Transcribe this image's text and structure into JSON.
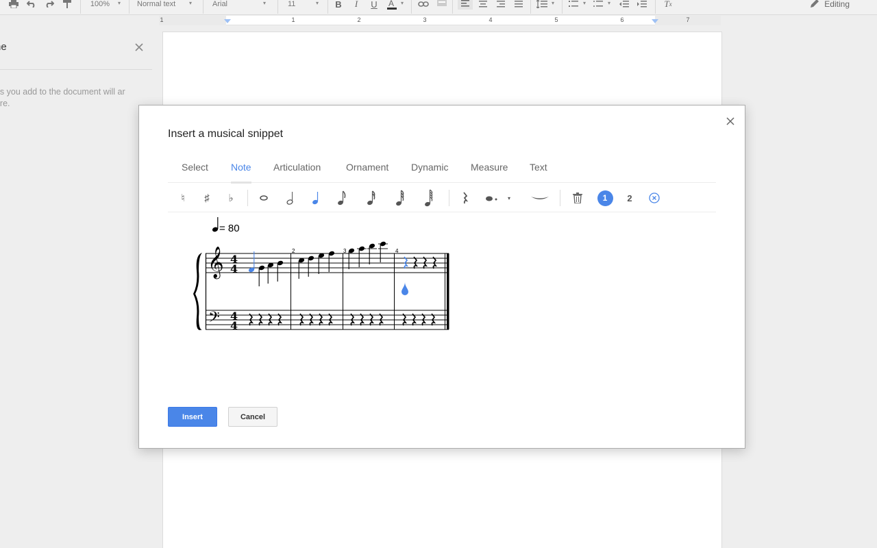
{
  "toolbar": {
    "zoom": "100%",
    "style": "Normal text",
    "font": "Arial",
    "font_size": "11",
    "mode": "Editing"
  },
  "ruler": {
    "numbers": [
      "1",
      "1",
      "2",
      "3",
      "4",
      "5",
      "6",
      "7"
    ]
  },
  "left_panel": {
    "title_fragment": "ne",
    "description_fragment": "ngs you add to the document will ar here."
  },
  "dialog": {
    "title": "Insert a musical snippet",
    "tabs": [
      "Select",
      "Note",
      "Articulation",
      "Ornament",
      "Dynamic",
      "Measure",
      "Text"
    ],
    "active_tab": "Note",
    "palette": {
      "voices": [
        "1",
        "2"
      ],
      "active_voice": "1",
      "icons": [
        "natural-icon",
        "sharp-icon",
        "flat-icon",
        "whole-note-icon",
        "half-note-icon",
        "quarter-note-icon",
        "eighth-note-icon",
        "sixteenth-note-icon",
        "thirty-second-note-icon",
        "sixty-fourth-note-icon",
        "rest-icon",
        "dot-icon",
        "tie-icon",
        "trash-icon",
        "clear-voice-icon"
      ]
    },
    "score": {
      "tempo": "= 80",
      "time_signature": "4/4",
      "measure_numbers": [
        "2",
        "3",
        "4"
      ]
    },
    "buttons": {
      "insert": "Insert",
      "cancel": "Cancel"
    }
  },
  "colors": {
    "accent": "#4a86e8",
    "selection": "#4a86e8"
  }
}
